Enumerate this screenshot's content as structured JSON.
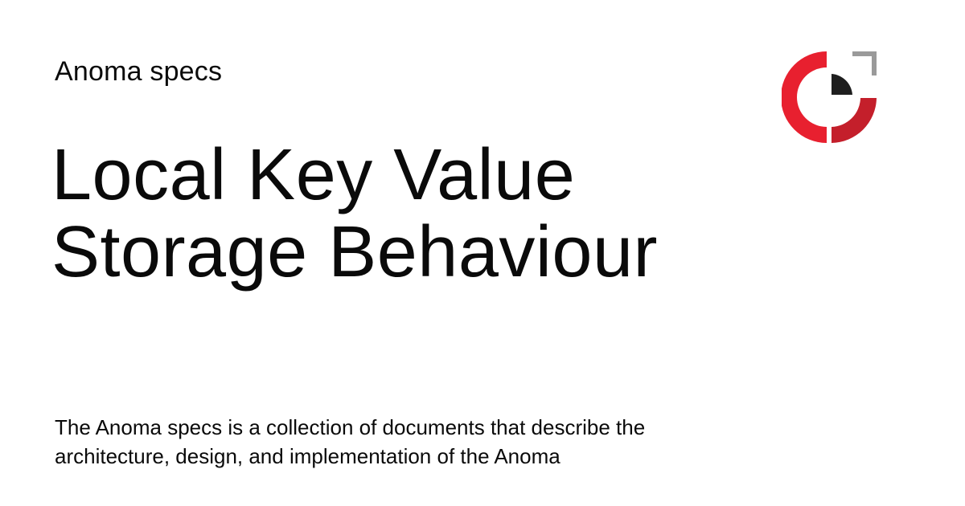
{
  "site": {
    "name": "Anoma specs"
  },
  "page": {
    "title": "Local Key Value Storage Behaviour",
    "description": "The Anoma specs is a collection of documents that describe the architecture, design, and implementation of the Anoma"
  },
  "logo": {
    "icon": "anoma-logo-icon",
    "colors": {
      "red_primary": "#e8202f",
      "red_dark": "#b51d26",
      "grey": "#9a9a9a",
      "black": "#1e1e1e"
    }
  }
}
